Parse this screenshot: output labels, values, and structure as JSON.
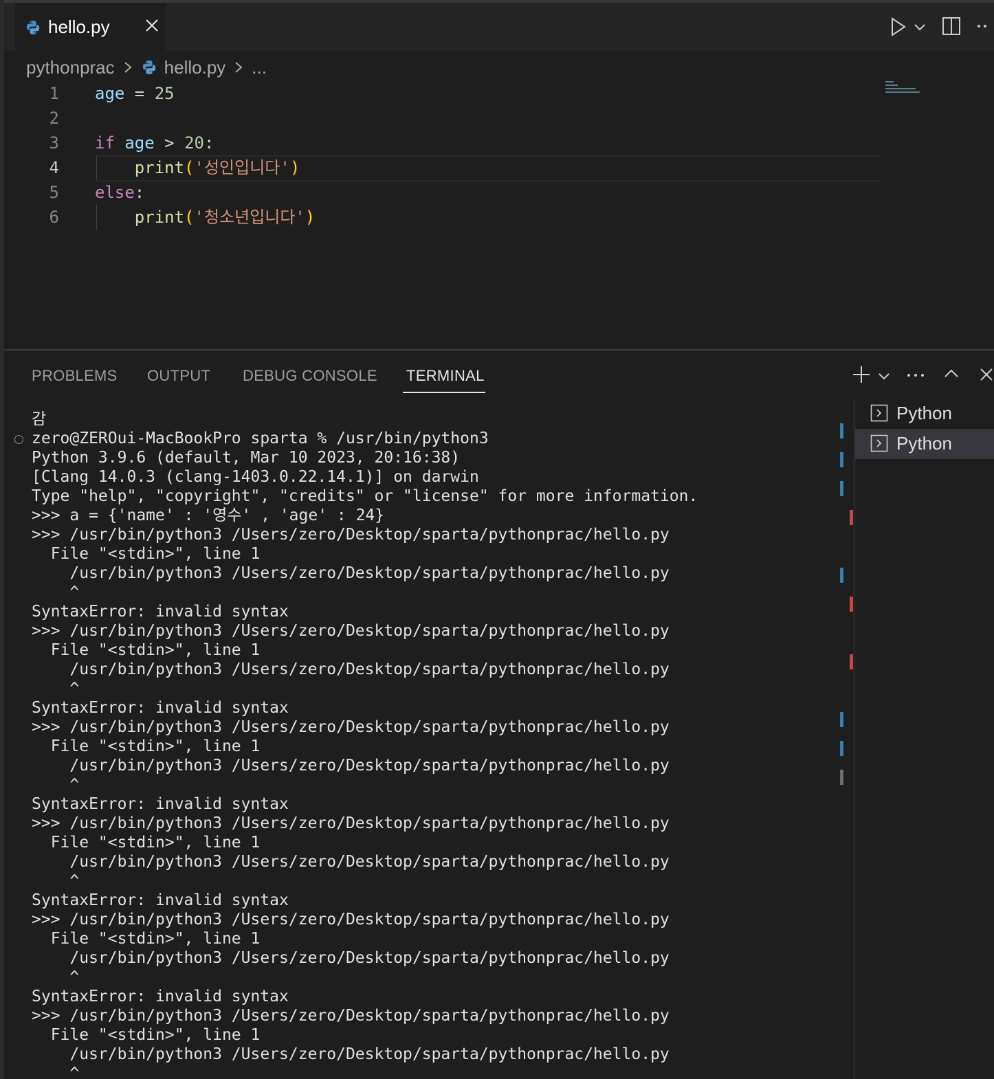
{
  "editor_tab": {
    "title": "hello.py"
  },
  "breadcrumb": {
    "folder": "pythonprac",
    "file": "hello.py",
    "more": "..."
  },
  "code_lines": [
    {
      "n": "1",
      "parts": [
        [
          "var",
          "age"
        ],
        [
          "plain",
          " = "
        ],
        [
          "num",
          "25"
        ]
      ]
    },
    {
      "n": "2",
      "parts": []
    },
    {
      "n": "3",
      "parts": [
        [
          "kw",
          "if"
        ],
        [
          "plain",
          " "
        ],
        [
          "var",
          "age"
        ],
        [
          "plain",
          " > "
        ],
        [
          "num",
          "20"
        ],
        [
          "plain",
          ":"
        ]
      ]
    },
    {
      "n": "4",
      "parts": [
        [
          "plain",
          "    "
        ],
        [
          "fn",
          "print"
        ],
        [
          "brk",
          "("
        ],
        [
          "str",
          "'성인입니다'"
        ],
        [
          "brk",
          ")"
        ]
      ]
    },
    {
      "n": "5",
      "parts": [
        [
          "kw",
          "else"
        ],
        [
          "plain",
          ":"
        ]
      ]
    },
    {
      "n": "6",
      "parts": [
        [
          "plain",
          "    "
        ],
        [
          "fn",
          "print"
        ],
        [
          "brk",
          "("
        ],
        [
          "str",
          "'청소년입니다'"
        ],
        [
          "brk",
          ")"
        ]
      ]
    }
  ],
  "active_line": "4",
  "panel_tabs": [
    "PROBLEMS",
    "OUTPUT",
    "DEBUG CONSOLE",
    "TERMINAL"
  ],
  "active_panel_tab": "TERMINAL",
  "terminal_lines": [
    "감",
    "zero@ZEROui-MacBookPro sparta % /usr/bin/python3",
    "Python 3.9.6 (default, Mar 10 2023, 20:16:38)",
    "[Clang 14.0.3 (clang-1403.0.22.14.1)] on darwin",
    "Type \"help\", \"copyright\", \"credits\" or \"license\" for more information.",
    ">>> a = {'name' : '영수' , 'age' : 24}",
    ">>> /usr/bin/python3 /Users/zero/Desktop/sparta/pythonprac/hello.py",
    "  File \"<stdin>\", line 1",
    "    /usr/bin/python3 /Users/zero/Desktop/sparta/pythonprac/hello.py",
    "    ^",
    "SyntaxError: invalid syntax",
    ">>> /usr/bin/python3 /Users/zero/Desktop/sparta/pythonprac/hello.py",
    "  File \"<stdin>\", line 1",
    "    /usr/bin/python3 /Users/zero/Desktop/sparta/pythonprac/hello.py",
    "    ^",
    "SyntaxError: invalid syntax",
    ">>> /usr/bin/python3 /Users/zero/Desktop/sparta/pythonprac/hello.py",
    "  File \"<stdin>\", line 1",
    "    /usr/bin/python3 /Users/zero/Desktop/sparta/pythonprac/hello.py",
    "    ^",
    "SyntaxError: invalid syntax",
    ">>> /usr/bin/python3 /Users/zero/Desktop/sparta/pythonprac/hello.py",
    "  File \"<stdin>\", line 1",
    "    /usr/bin/python3 /Users/zero/Desktop/sparta/pythonprac/hello.py",
    "    ^",
    "SyntaxError: invalid syntax",
    ">>> /usr/bin/python3 /Users/zero/Desktop/sparta/pythonprac/hello.py",
    "  File \"<stdin>\", line 1",
    "    /usr/bin/python3 /Users/zero/Desktop/sparta/pythonprac/hello.py",
    "    ^",
    "SyntaxError: invalid syntax",
    ">>> /usr/bin/python3 /Users/zero/Desktop/sparta/pythonprac/hello.py",
    "  File \"<stdin>\", line 1",
    "    /usr/bin/python3 /Users/zero/Desktop/sparta/pythonprac/hello.py",
    "    ^"
  ],
  "terminal_instances": [
    {
      "label": "Python",
      "selected": false
    },
    {
      "label": "Python",
      "selected": true
    }
  ],
  "colors": {
    "background": "#1e1e1e",
    "tabbar": "#252526",
    "keyword": "#c586c0",
    "variable": "#9cdcfe",
    "number": "#b5cea8",
    "function": "#dcdcaa",
    "string": "#ce9178",
    "bracket": "#ffd700",
    "scroll_marker_blue": "#3c7ea8",
    "scroll_marker_red": "#c44a4a"
  },
  "icons": [
    "python-file-icon",
    "close-icon",
    "run-icon",
    "chevron-down-icon",
    "split-editor-icon",
    "more-icon",
    "chevron-right-icon",
    "add-terminal-icon",
    "maximize-panel-icon",
    "close-panel-icon",
    "terminal-icon"
  ]
}
